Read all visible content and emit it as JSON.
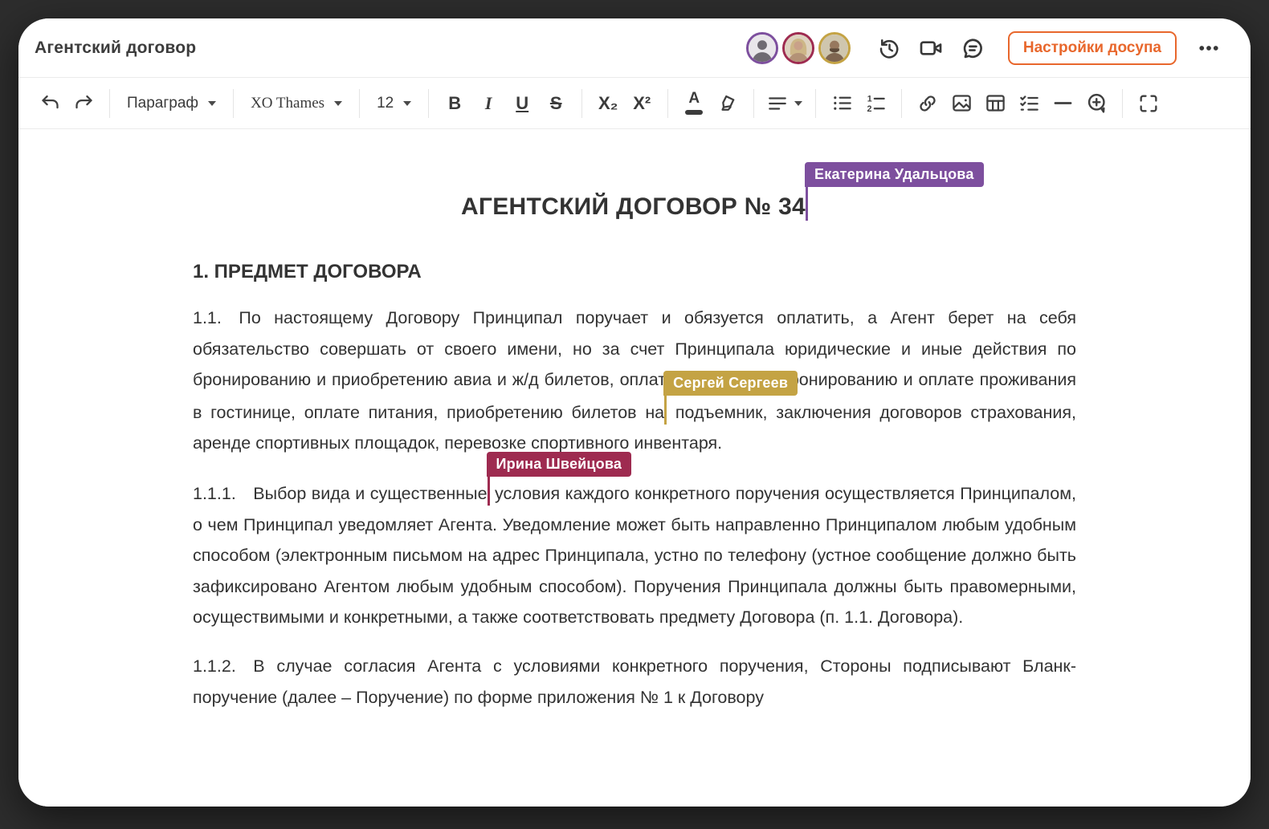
{
  "accent_color": "#e8672c",
  "window": {
    "title": "Агентский договор",
    "share_button_label": "Настройки досупа"
  },
  "collaborators": [
    {
      "name": "Екатерина Удальцова",
      "color": "#7d4f9e"
    },
    {
      "name": "Ирина Швейцова",
      "color": "#9e2b50"
    },
    {
      "name": "Сергей Сергеев",
      "color": "#c4a344"
    }
  ],
  "topbar_icons": [
    "history-icon",
    "video-call-icon",
    "chat-icon",
    "more-icon"
  ],
  "toolbar": {
    "paragraph_style": "Параграф",
    "font_name": "XO Thames",
    "font_size": "12",
    "icons": [
      "undo-icon",
      "redo-icon",
      "bold-icon",
      "italic-icon",
      "underline-icon",
      "strikethrough-icon",
      "subscript-icon",
      "superscript-icon",
      "font-color-icon",
      "highlight-icon",
      "align-icon",
      "bullet-list-icon",
      "numbered-list-icon",
      "link-icon",
      "image-icon",
      "table-icon",
      "checklist-icon",
      "horizontal-rule-icon",
      "add-comment-icon",
      "fullscreen-icon"
    ]
  },
  "document": {
    "title": "АГЕНТСКИЙ ДОГОВОР № 34",
    "section_heading": "1. ПРЕДМЕТ ДОГОВОРА",
    "p11_before": "1.1. По настоящему Договору Принципал поручает и обязуется оплатить, а Агент берет на себя обязательство совершать от своего имени, но за счет Принципала юридические и иные действия по бронированию и приобретению авиа и ж/д билетов, оплате трансфера, бронированию и оплате проживания в гостинице, оплате питания, приобретению билетов на",
    "p11_after": " подъемник, заключения договоров страхования, аренде спортивных площадок, перевозке спортивного инвентаря.",
    "p111_before": "1.1.1. Выбор вида и существенные",
    "p111_after": " условия каждого конкретного поручения осуществляется Принципалом, о чем Принципал уведомляет Агента. Уведомление может быть направленно Принципалом любым удобным способом (электронным письмом на адрес Принципала, устно по телефону (устное сообщение должно быть зафиксировано Агентом любым удобным способом). Поручения Принципала должны быть правомерными, осуществимыми и конкретными, а также соответствовать предмету Договора (п. 1.1. Договора).",
    "p112": "1.1.2. В случае согласия Агента с условиями конкретного поручения, Стороны подписывают Бланк-поручение (далее – Поручение) по форме приложения № 1 к Договору"
  }
}
